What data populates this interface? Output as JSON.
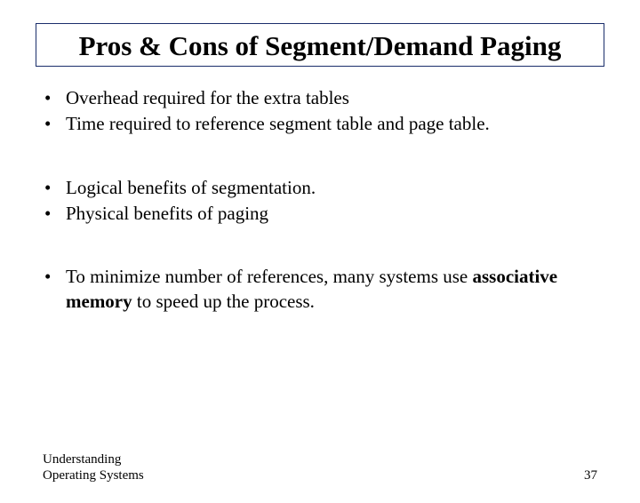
{
  "title": "Pros & Cons of Segment/Demand Paging",
  "groups": [
    {
      "items": [
        {
          "text": "Overhead required for the extra tables"
        },
        {
          "text": "Time required to reference segment table and page table."
        }
      ]
    },
    {
      "items": [
        {
          "text": "Logical benefits of segmentation."
        },
        {
          "text": "Physical benefits of paging"
        }
      ]
    },
    {
      "items": [
        {
          "prefix": "To minimize number of references, many systems use ",
          "bold": "associative memory",
          "suffix": " to speed up the process."
        }
      ]
    }
  ],
  "footer": {
    "left_line1": "Understanding",
    "left_line2": "Operating Systems",
    "page": "37"
  },
  "bullet_char": "•"
}
